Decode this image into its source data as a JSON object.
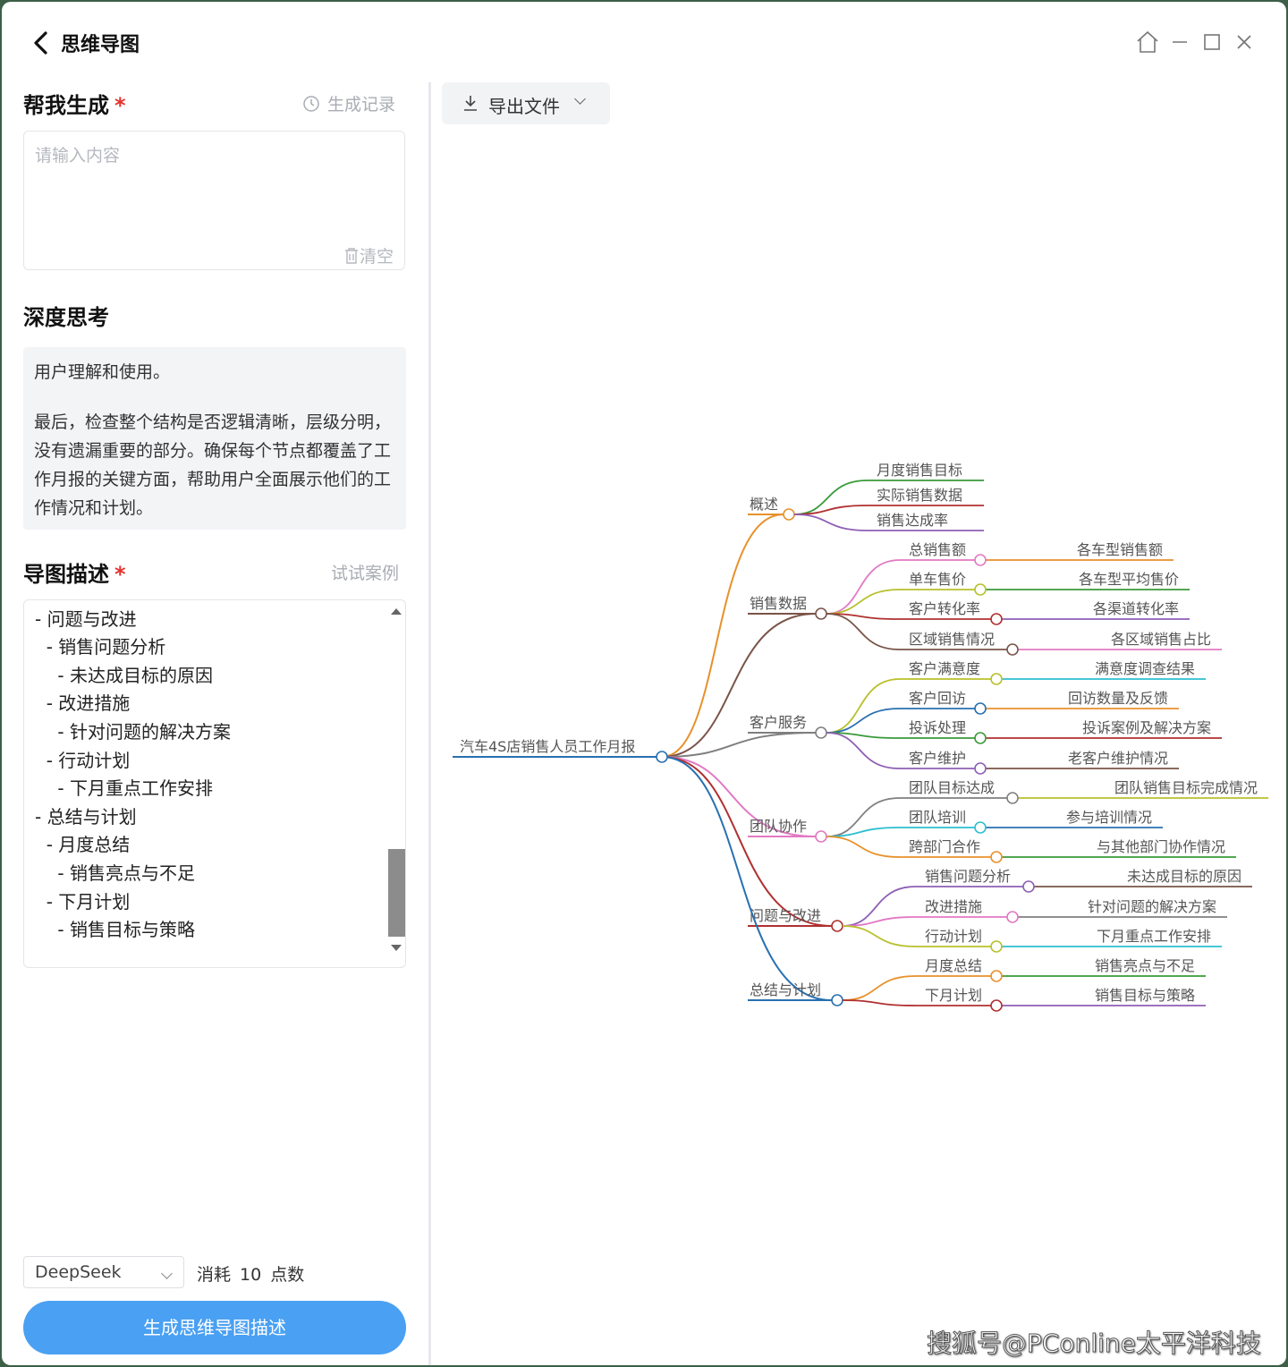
{
  "app": {
    "title": "思维导图"
  },
  "generate": {
    "title": "帮我生成",
    "required_mark": "*",
    "history_label": "生成记录",
    "input_placeholder": "请输入内容",
    "clear_label": "清空"
  },
  "deep_thinking": {
    "title": "深度思考",
    "paragraphs": [
      "用户理解和使用。",
      "最后，检查整个结构是否逻辑清晰，层级分明，没有遗漏重要的部分。确保每个节点都覆盖了工作月报的关键方面，帮助用户全面展示他们的工作情况和计划。"
    ]
  },
  "map_desc": {
    "title": "导图描述",
    "required_mark": "*",
    "example_label": "试试案例",
    "lines": [
      "    - 与其他部门协作情况",
      "- 问题与改进",
      "  - 销售问题分析",
      "    - 未达成目标的原因",
      "  - 改进措施",
      "    - 针对问题的解决方案",
      "  - 行动计划",
      "    - 下月重点工作安排",
      "- 总结与计划",
      "  - 月度总结",
      "    - 销售亮点与不足",
      "  - 下月计划",
      "    - 销售目标与策略"
    ]
  },
  "footer": {
    "model": "DeepSeek",
    "cost_prefix": "消耗",
    "cost_value": "10",
    "cost_suffix": "点数",
    "generate_button": "生成思维导图描述"
  },
  "export": {
    "label": "导出文件"
  },
  "mindmap": {
    "root": "汽车4S店销售人员工作月报",
    "branches": [
      {
        "label": "概述",
        "color": "#e8912b",
        "children": [
          {
            "label": "月度销售目标",
            "color": "#3a9a3a"
          },
          {
            "label": "实际销售数据",
            "color": "#b03030"
          },
          {
            "label": "销售达成率",
            "color": "#8e5fb5"
          }
        ]
      },
      {
        "label": "销售数据",
        "color": "#7a5448",
        "children": [
          {
            "label": "总销售额",
            "color": "#e279c4",
            "leaf": "各车型销售额",
            "leaf_color": "#e8912b"
          },
          {
            "label": "单车售价",
            "color": "#b8c02a",
            "leaf": "各车型平均售价",
            "leaf_color": "#3a9a3a"
          },
          {
            "label": "客户转化率",
            "color": "#b03030",
            "leaf": "各渠道转化率",
            "leaf_color": "#8e5fb5"
          },
          {
            "label": "区域销售情况",
            "color": "#7a5448",
            "leaf": "各区域销售占比",
            "leaf_color": "#e279c4"
          }
        ]
      },
      {
        "label": "客户服务",
        "color": "#7f7f7f",
        "children": [
          {
            "label": "客户满意度",
            "color": "#b8c02a",
            "leaf": "满意度调查结果",
            "leaf_color": "#2cbfd0"
          },
          {
            "label": "客户回访",
            "color": "#2870b0",
            "leaf": "回访数量及反馈",
            "leaf_color": "#e8912b"
          },
          {
            "label": "投诉处理",
            "color": "#3a9a3a",
            "leaf": "投诉案例及解决方案",
            "leaf_color": "#b03030"
          },
          {
            "label": "客户维护",
            "color": "#8e5fb5",
            "leaf": "老客户维护情况",
            "leaf_color": "#7a5448"
          }
        ]
      },
      {
        "label": "团队协作",
        "color": "#e279c4",
        "children": [
          {
            "label": "团队目标达成",
            "color": "#7f7f7f",
            "leaf": "团队销售目标完成情况",
            "leaf_color": "#b8c02a"
          },
          {
            "label": "团队培训",
            "color": "#2cbfd0",
            "leaf": "参与培训情况",
            "leaf_color": "#2870b0"
          },
          {
            "label": "跨部门合作",
            "color": "#e8912b",
            "leaf": "与其他部门协作情况",
            "leaf_color": "#3a9a3a"
          }
        ]
      },
      {
        "label": "问题与改进",
        "color": "#b03030",
        "children": [
          {
            "label": "销售问题分析",
            "color": "#8e5fb5",
            "leaf": "未达成目标的原因",
            "leaf_color": "#7a5448"
          },
          {
            "label": "改进措施",
            "color": "#e279c4",
            "leaf": "针对问题的解决方案",
            "leaf_color": "#7f7f7f"
          },
          {
            "label": "行动计划",
            "color": "#b8c02a",
            "leaf": "下月重点工作安排",
            "leaf_color": "#2cbfd0"
          }
        ]
      },
      {
        "label": "总结与计划",
        "color": "#2870b0",
        "children": [
          {
            "label": "月度总结",
            "color": "#e8912b",
            "leaf": "销售亮点与不足",
            "leaf_color": "#3a9a3a"
          },
          {
            "label": "下月计划",
            "color": "#b03030",
            "leaf": "销售目标与策略",
            "leaf_color": "#8e5fb5"
          }
        ]
      }
    ]
  },
  "watermark": "搜狐号@PConline太平洋科技"
}
